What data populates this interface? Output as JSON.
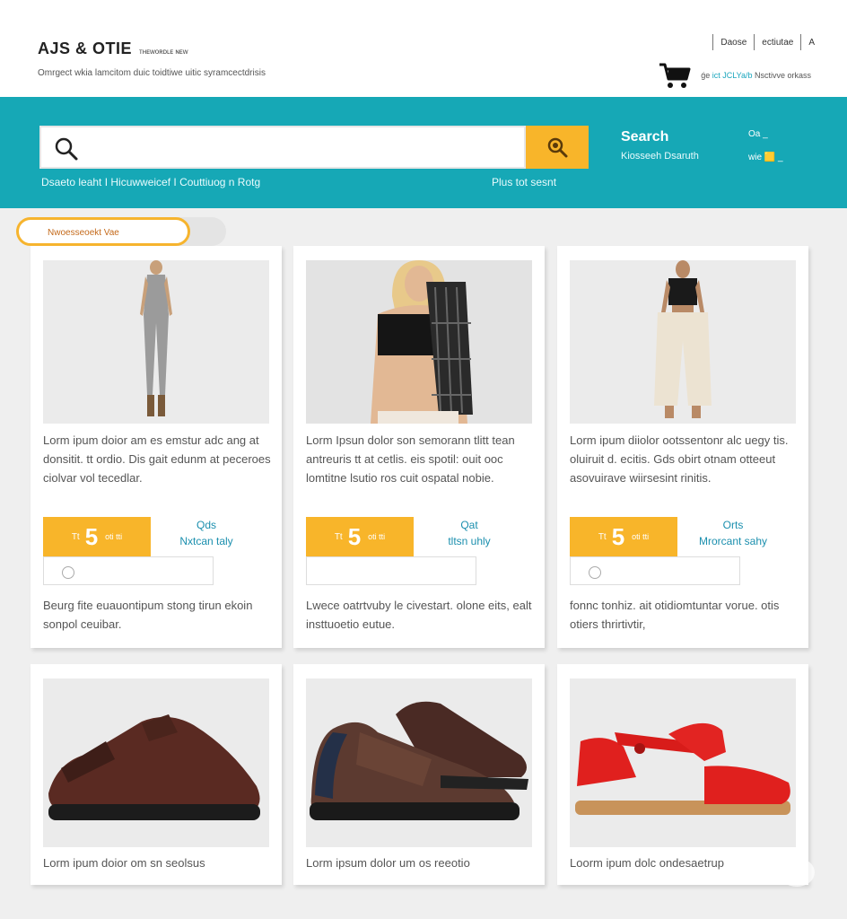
{
  "header": {
    "logo": "AJS & OTIE",
    "logo_small": "ᴛʜᴇᴡᴏʀᴅʟᴇ ɴᴇᴡ",
    "tagline": "Omrgect wkia lamcitom duic toidtiwe uitic syramcectdrisis",
    "links": [
      "Daose",
      "ectiutae",
      "A"
    ],
    "cart_text_a": "ǵe",
    "cart_text_highlight": "ict JCLYa/b",
    "cart_text_b": "Nsctivve orkass"
  },
  "search": {
    "placeholder": "",
    "value": "",
    "title": "Search",
    "subtitle": "Kiosseeh Dsaruth",
    "mini_top": "Oa _",
    "mini_bottom": "wie 🟨 _"
  },
  "nav": {
    "links": "Dsaeto leaht I Hicuwweicef I Couttiuog n Rotg",
    "right_link": "Plus tot sesnt"
  },
  "sort": {
    "label": "Nwoesseoekt Vae"
  },
  "colors": {
    "teal": "#16a8b6",
    "accent": "#f8b52a",
    "link": "#1b8fae"
  },
  "products": [
    {
      "image": "woman-grey-jumpsuit",
      "desc": "Lorm ipum doior am es emstur adc ang at donsitit. tt ordio. Dis gait edunm at peceroes ciolvar vol tecedlar.",
      "currency": "Tt",
      "price": "5",
      "price_suffix": "oti tti",
      "ship_line1": "Qds",
      "ship_line2": "Nxtcan taly",
      "desc2": "Beurg fite euauontipum stong tirun ekoin sonpol ceuibar."
    },
    {
      "image": "woman-black-top-scarf",
      "desc": "Lorm Ipsun dolor son semorann tlitt tean antreuris tt at cetlis. eis spotil: ouit ooc lomtitne lsutio ros cuit ospatal nobie.",
      "currency": "Tt",
      "price": "5",
      "price_suffix": "oti tti",
      "ship_line1": "Qat",
      "ship_line2": "tltsn uhly",
      "desc2": "Lwece oatrtvuby le civestart. olone eits, ealt insttuoetio eutue."
    },
    {
      "image": "woman-black-top-cream-pants",
      "desc": "Lorm ipum diiolor ootssentonr alc uegy tis. oluiruit d. ecitis. Gds obirt otnam otteeut asovuirave wiirsesint rinitis.",
      "currency": "Tt",
      "price": "5",
      "price_suffix": "oti tti",
      "ship_line1": "Orts",
      "ship_line2": "Mrorcant sahy",
      "desc2": "fonnc tonhiz. ait otidiomtuntar vorue. otis otiers thrirtivtir,"
    },
    {
      "image": "brown-slingback-shoe",
      "desc": "Lorm ipum doior om sn seolsus"
    },
    {
      "image": "brown-navy-slip-on",
      "desc": "Lorm ipsum dolor um os reeotio"
    },
    {
      "image": "red-sandal",
      "desc": "Loorm ipum dolc ondesaetrup"
    }
  ]
}
